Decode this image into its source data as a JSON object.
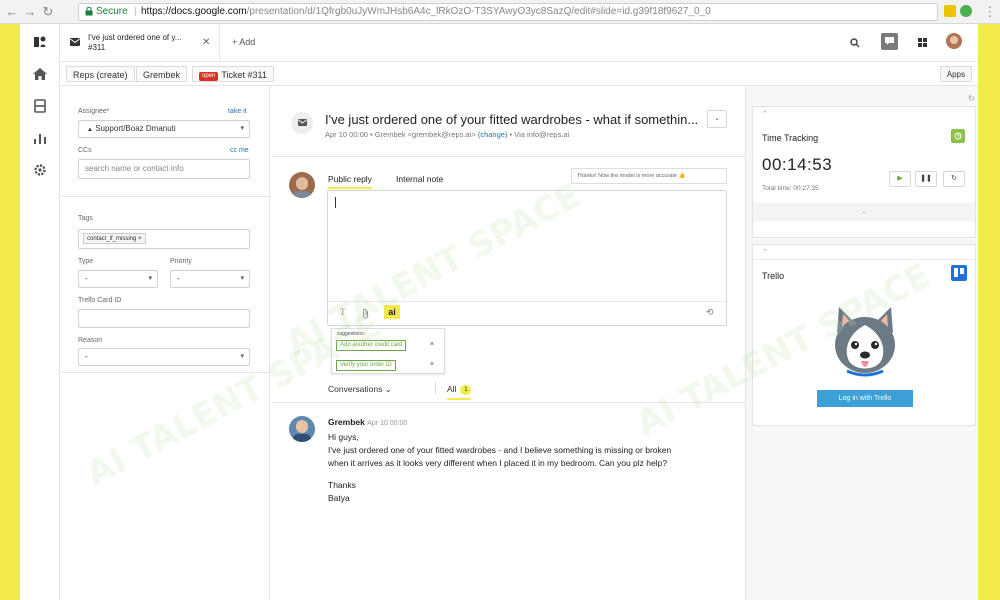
{
  "browser": {
    "secure_label": "Secure",
    "url_host": "https://docs.google.com",
    "url_path": "/presentation/d/1Qfrgb0uJyWmJHsb6A4c_lRkOzO-T3SYAwyO3yc8SazQ/edit#slide=id.g39f18f9627_0_0"
  },
  "app": {
    "accent_color": "#f3ea4c",
    "tab": {
      "title_line1": "I've just ordered one of y...",
      "title_line2": "#311"
    },
    "add_label": "+ Add",
    "breadcrumbs": [
      "Reps (create)",
      "Grembek"
    ],
    "ticket_badge": "open",
    "ticket_label": "Ticket #311",
    "apps_label": "Apps"
  },
  "properties": {
    "assignee_label": "Assignee*",
    "take_it": "take it",
    "assignee_value": "Support/Boaz Dmanuti",
    "ccs_label": "CCs",
    "cc_me": "cc me",
    "ccs_placeholder": "search name or contact info",
    "tags_label": "Tags",
    "tag_value": "contact_if_missing ×",
    "type_label": "Type",
    "type_value": "-",
    "priority_label": "Priority",
    "priority_value": "-",
    "trello_id_label": "Trello Card ID",
    "reason_label": "Reason",
    "reason_value": "-"
  },
  "ticket": {
    "subject": "I've just ordered one of your fitted wardrobes - what if somethin...",
    "date": "Apr 10 00:00",
    "requester": "Grembek <grembek@reps.ai>",
    "change": "(change)",
    "via": "Via info@reps.ai",
    "public_reply": "Public reply",
    "internal_note": "Internal note",
    "feedback": "Thanks! Now the model is more accurate",
    "suggestions_label": "suggestions:",
    "suggestions": [
      "Add another credit card",
      "Verify your order ID"
    ],
    "conversations_label": "Conversations ⌄",
    "all_label": "All",
    "all_count": "1"
  },
  "message": {
    "author": "Grembek",
    "date": "Apr 10 00:00",
    "greeting": "Hi guys,",
    "line1": "I've just ordered one of your fitted wardrobes - and I believe something is missing or broken",
    "line2": "when it arrives as it looks very different when I placed it in my bedroom. Can you plz help?",
    "thanks": "Thanks",
    "signature": "Batya"
  },
  "time_tracking": {
    "title": "Time Tracking",
    "timer": "00:14:53",
    "total": "Total time: 00:27:35"
  },
  "trello": {
    "title": "Trello",
    "login_label": "Log in with Trello"
  },
  "watermark": "AI TALENT SPACE"
}
